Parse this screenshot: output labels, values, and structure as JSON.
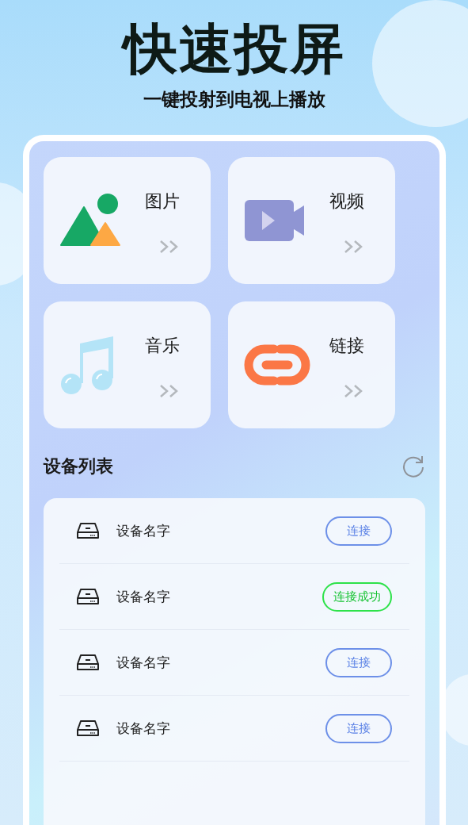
{
  "header": {
    "title": "快速投屏",
    "subtitle": "一键投射到电视上播放"
  },
  "media_cards": [
    {
      "kind": "image",
      "label": "图片"
    },
    {
      "kind": "video",
      "label": "视频"
    },
    {
      "kind": "music",
      "label": "音乐"
    },
    {
      "kind": "link",
      "label": "链接"
    }
  ],
  "device_list": {
    "title": "设备列表",
    "devices": [
      {
        "name": "设备名字",
        "button": "连接",
        "connected": false
      },
      {
        "name": "设备名字",
        "button": "连接成功",
        "connected": true
      },
      {
        "name": "设备名字",
        "button": "连接",
        "connected": false
      },
      {
        "name": "设备名字",
        "button": "连接",
        "connected": false
      }
    ]
  }
}
